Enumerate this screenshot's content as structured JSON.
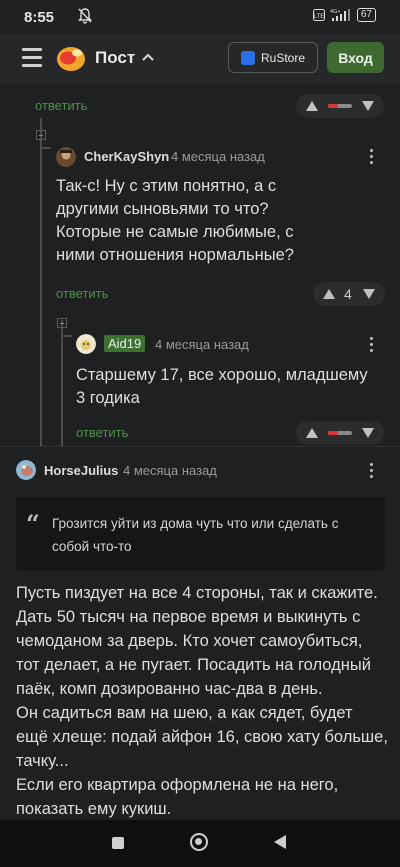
{
  "status_bar": {
    "time": "8:55",
    "network": "4G+",
    "lte": "LTE",
    "battery": "67"
  },
  "header": {
    "title": "Пост",
    "rustore_label": "RuStore",
    "login_label": "Вход"
  },
  "comments": [
    {
      "id": "c0",
      "reply_label": "ответить"
    },
    {
      "id": "c1",
      "author": "CherKayShyn",
      "date": "4 месяца назад",
      "text": "Так-с! Ну с этим понятно, а с другими сыновьями то что? Которые не самые любимые, с ними отношения нормальные?",
      "reply_label": "ответить",
      "score": "4"
    },
    {
      "id": "c2",
      "author": "Aid19",
      "date": "4 месяца назад",
      "text": "Старшему 17, все хорошо, младшему 3 годика",
      "reply_label": "ответить"
    },
    {
      "id": "c3",
      "author": "HorseJulius",
      "date": "4 месяца назад",
      "quote": "Грозится уйти из дома чуть что или сделать с собой что-то",
      "paragraphs": [
        "Пусть пиздует на все 4 стороны, так и скажите. Дать 50 тысяч на первое время и выкинуть с чемоданом за дверь. Кто хочет самоубиться, тот делает, а не пугает. Посадить на голодный паёк, комп дозированно час-два в день.",
        "Он садиться вам на шею, а как сядет, будет ещё хлеще: подай айфон 16, свою хату больше, тачку...",
        "Если его квартира оформлена не на него, показать ему кукиш."
      ]
    }
  ],
  "vote_bar": {
    "negative_fraction": 0.4,
    "negative_color": "#d9382f",
    "neutral_color": "#8a8a8a"
  },
  "colors": {
    "accent_green": "#3e6a32",
    "reply_green": "#4f8e4a",
    "background": "#1f2021"
  }
}
